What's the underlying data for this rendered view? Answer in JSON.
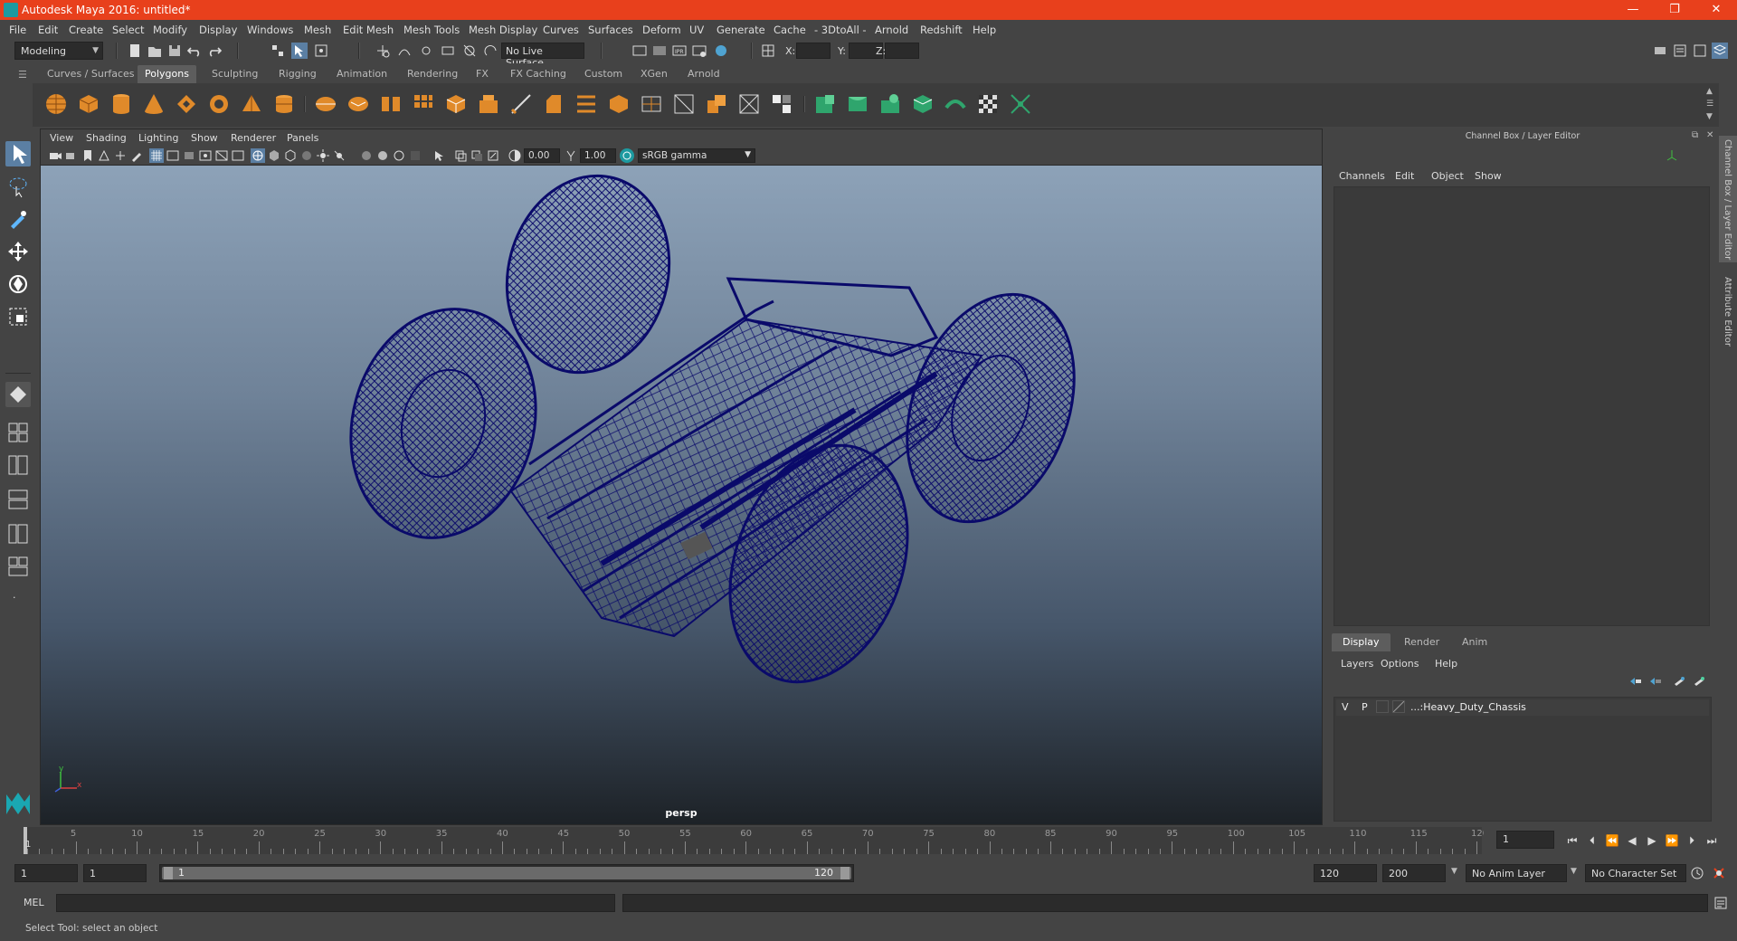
{
  "window": {
    "title": "Autodesk Maya 2016: untitled*",
    "minimize": "—",
    "restore": "❐",
    "close": "✕"
  },
  "menu": [
    "File",
    "Edit",
    "Create",
    "Select",
    "Modify",
    "Display",
    "Windows",
    "Mesh",
    "Edit Mesh",
    "Mesh Tools",
    "Mesh Display",
    "Curves",
    "Surfaces",
    "Deform",
    "UV",
    "Generate",
    "Cache",
    "- 3DtoAll -",
    "Arnold",
    "Redshift",
    "Help"
  ],
  "status": {
    "mode": "Modeling",
    "live_surface": "No Live Surface",
    "x_label": "X:",
    "y_label": "Y:",
    "z_label": "Z:"
  },
  "shelf_tabs": [
    "Curves / Surfaces",
    "Polygons",
    "Sculpting",
    "Rigging",
    "Animation",
    "Rendering",
    "FX",
    "FX Caching",
    "Custom",
    "XGen",
    "Arnold"
  ],
  "shelf_active": "Polygons",
  "viewport": {
    "menu": [
      "View",
      "Shading",
      "Lighting",
      "Show",
      "Renderer",
      "Panels"
    ],
    "exposure": "0.00",
    "gamma": "1.00",
    "color_space": "sRGB gamma",
    "camera_label": "persp",
    "axis_y": "y",
    "axis_x": "x"
  },
  "channel_box": {
    "title": "Channel Box / Layer Editor",
    "menu": [
      "Channels",
      "Edit",
      "Object",
      "Show"
    ],
    "tabs": [
      "Display",
      "Render",
      "Anim"
    ],
    "active_tab": "Display",
    "layer_menu": [
      "Layers",
      "Options",
      "Help"
    ],
    "layer": {
      "v": "V",
      "p": "P",
      "name": "...:Heavy_Duty_Chassis"
    },
    "side_tab_1": "Channel Box / Layer Editor",
    "side_tab_2": "Attribute Editor"
  },
  "timeline": {
    "ticks": [
      "5",
      "10",
      "15",
      "20",
      "25",
      "30",
      "35",
      "40",
      "45",
      "50",
      "55",
      "60",
      "65",
      "70",
      "75",
      "80",
      "85",
      "90",
      "95",
      "100",
      "105",
      "110",
      "115",
      "120"
    ],
    "start_label": "1",
    "current_frame": "1"
  },
  "range": {
    "start": "1",
    "start_inner": "1",
    "slider_start": "1",
    "slider_end": "120",
    "end": "120",
    "end_outer": "200",
    "anim_layer": "No Anim Layer",
    "char_set": "No Character Set"
  },
  "command": {
    "label": "MEL"
  },
  "help_line": "Select Tool: select an object",
  "colors": {
    "title_bar": "#e8401c",
    "wireframe": "#0a0a6a",
    "active_tool": "#5b7fa3",
    "shelf_green": "#2fa56d",
    "shelf_orange": "#e08a2a"
  }
}
